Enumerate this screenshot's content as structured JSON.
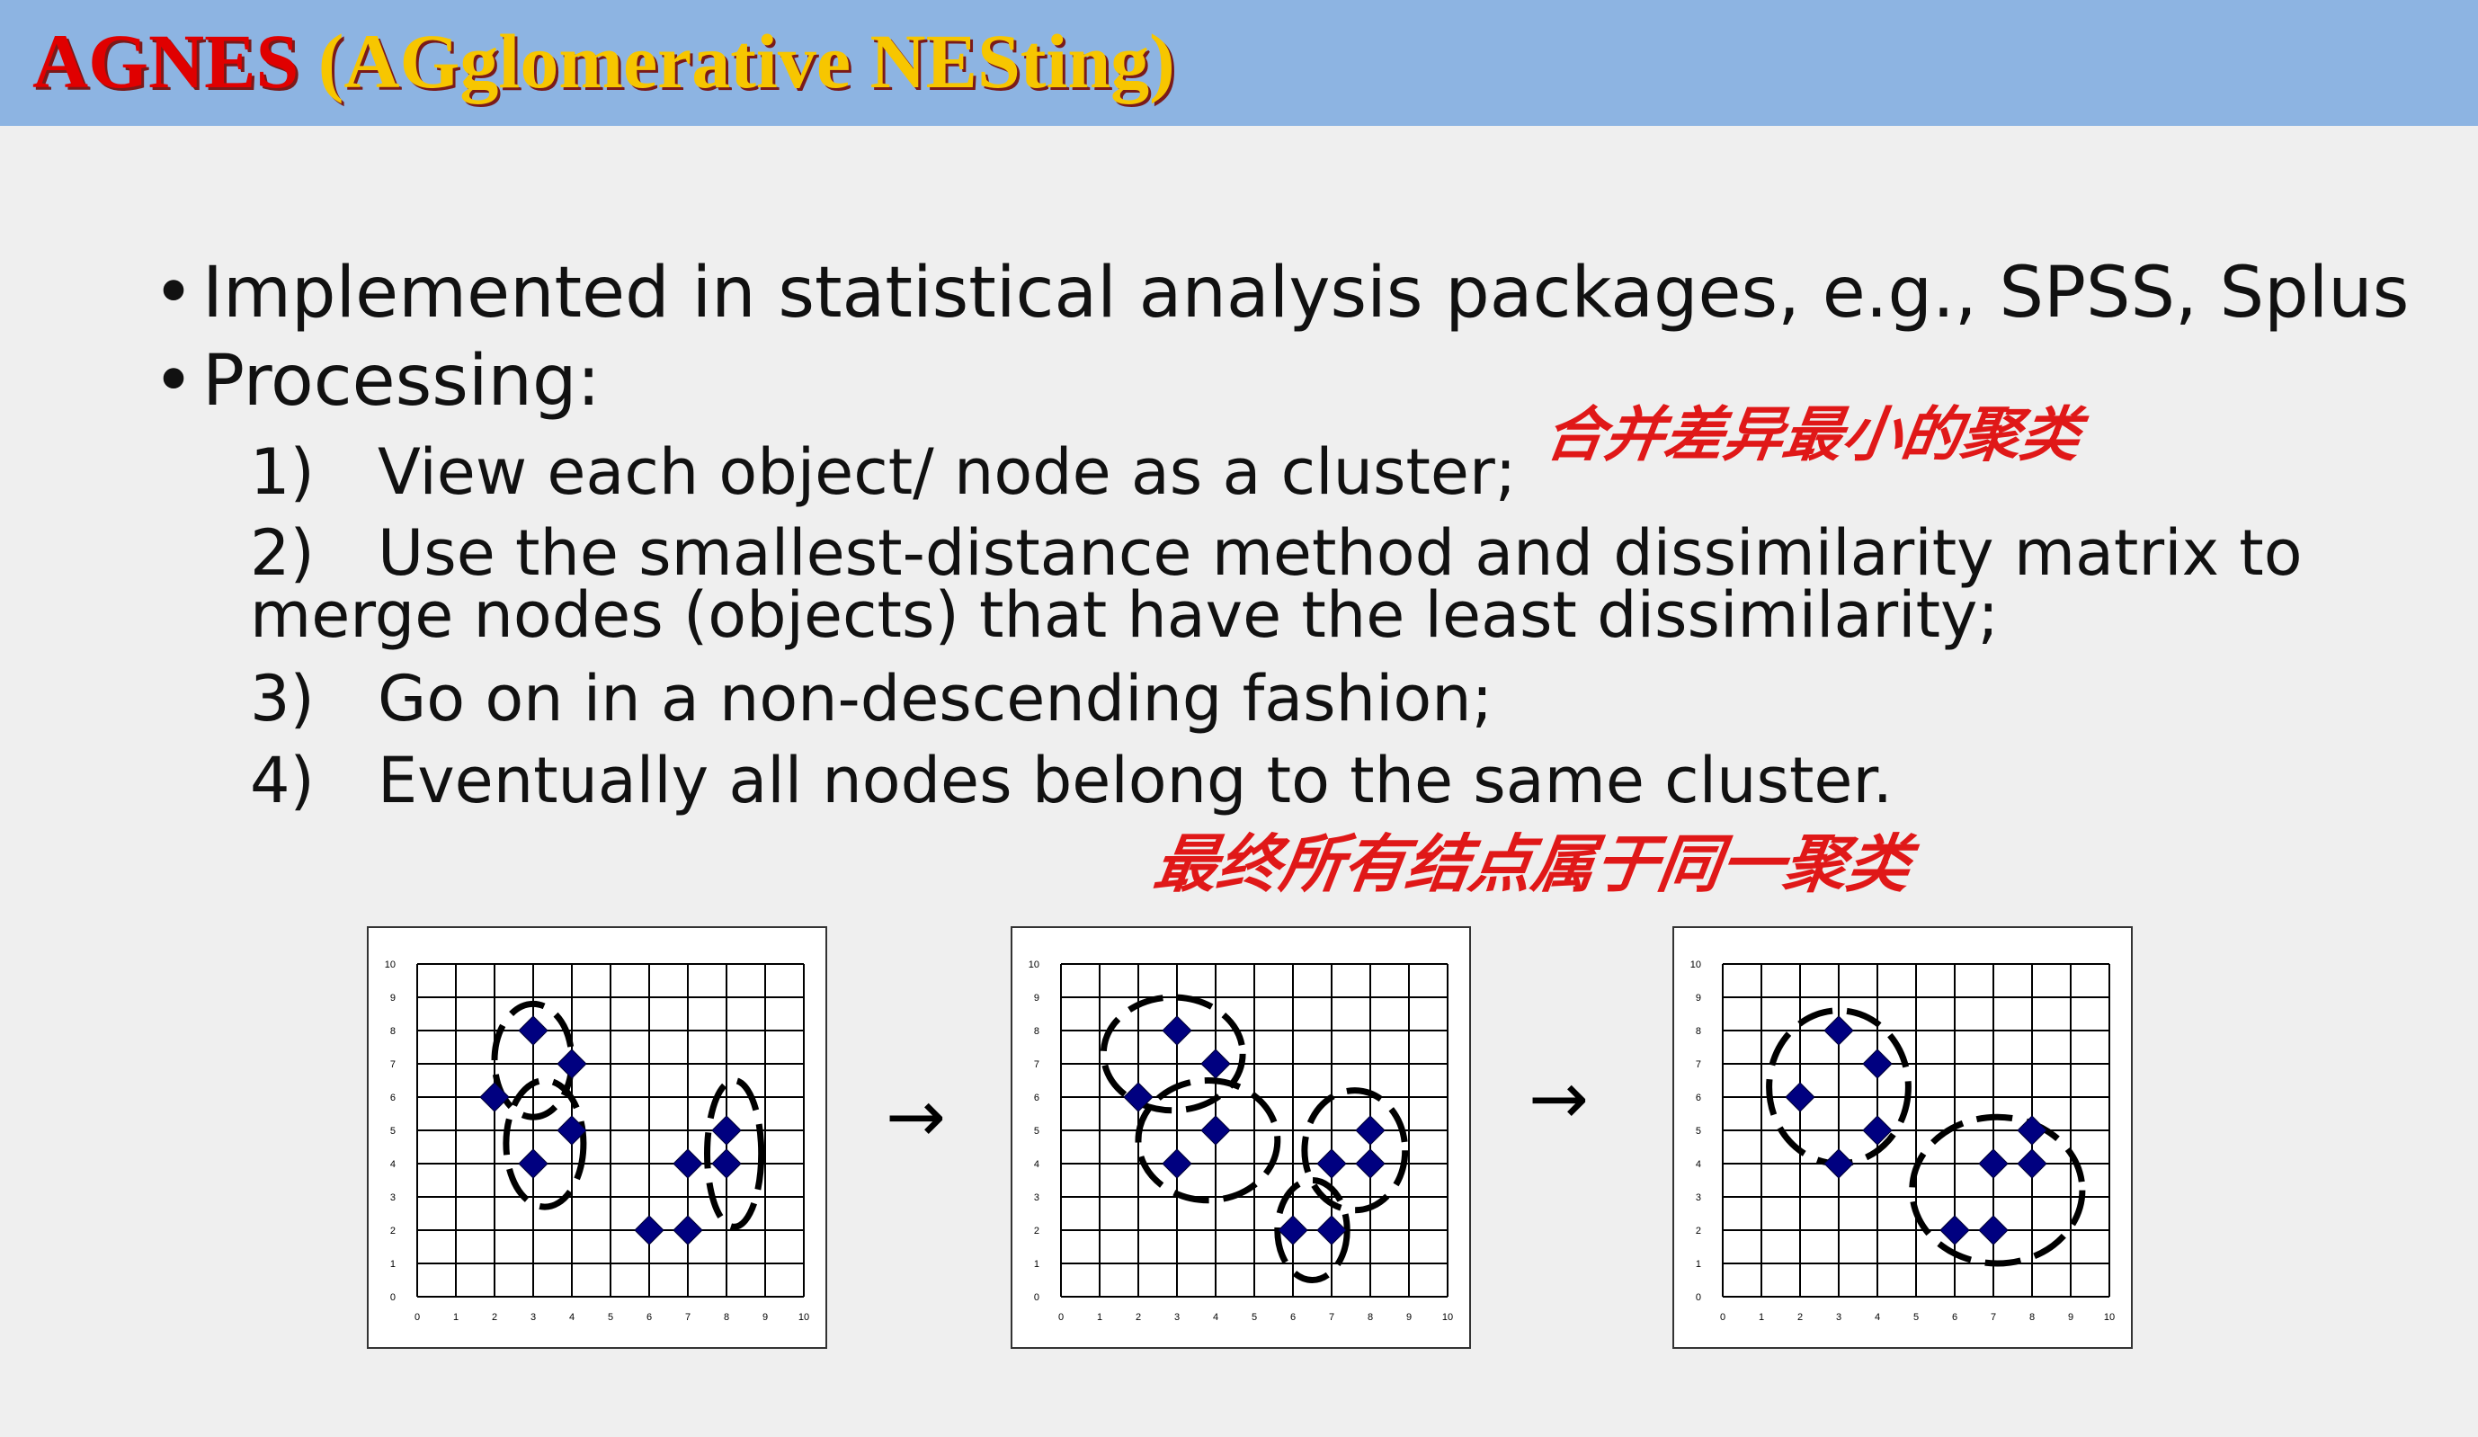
{
  "header": {
    "title_main": "AGNES ",
    "title_sub": "(AGglomerative NESting)"
  },
  "bullets": [
    "Implemented in statistical analysis packages, e.g., SPSS,  Splus",
    "Processing:"
  ],
  "bullet_glyph": "•",
  "steps": [
    {
      "num": "1)",
      "text": "View each object/ node as a cluster;"
    },
    {
      "num": "2)",
      "text": "Use the smallest-distance method and dissimilarity matrix to"
    },
    {
      "num": "",
      "text": "merge nodes (objects) that have the least dissimilarity;"
    },
    {
      "num": "3)",
      "text": "Go on in a non-descending fashion;"
    },
    {
      "num": "4)",
      "text": "Eventually all nodes belong to the same cluster."
    }
  ],
  "annotations": {
    "note1": "合并差异最小的聚类",
    "note2": "最终所有结点属于同一聚类"
  },
  "arrow_glyph": "→",
  "colors": {
    "header_bg": "#8db4e2",
    "title_red": "#e00000",
    "title_yellow": "#f7c600",
    "point": "#000080",
    "ink": "#e01818"
  },
  "chart_data": [
    {
      "type": "scatter",
      "xlim": [
        0,
        10
      ],
      "ylim": [
        0,
        10
      ],
      "x_ticks": [
        "0",
        "1",
        "2",
        "3",
        "4",
        "5",
        "6",
        "7",
        "8",
        "9",
        "10"
      ],
      "y_ticks": [
        "0",
        "1",
        "2",
        "3",
        "4",
        "5",
        "6",
        "7",
        "8",
        "9",
        "10"
      ],
      "points": [
        [
          2,
          6
        ],
        [
          3,
          8
        ],
        [
          4,
          7
        ],
        [
          4,
          5
        ],
        [
          3,
          4
        ],
        [
          6,
          2
        ],
        [
          7,
          2
        ],
        [
          7,
          4
        ],
        [
          8,
          5
        ],
        [
          8,
          4
        ]
      ],
      "clusters": [
        {
          "cx": 3,
          "cy": 7.1,
          "rx": 1.0,
          "ry": 1.7
        },
        {
          "cx": 3.3,
          "cy": 4.6,
          "rx": 1.0,
          "ry": 1.9
        },
        {
          "cx": 8.2,
          "cy": 4.3,
          "rx": 0.7,
          "ry": 2.2
        }
      ]
    },
    {
      "type": "scatter",
      "xlim": [
        0,
        10
      ],
      "ylim": [
        0,
        10
      ],
      "x_ticks": [
        "0",
        "1",
        "2",
        "3",
        "4",
        "5",
        "6",
        "7",
        "8",
        "9",
        "10"
      ],
      "y_ticks": [
        "0",
        "1",
        "2",
        "3",
        "4",
        "5",
        "6",
        "7",
        "8",
        "9",
        "10"
      ],
      "points": [
        [
          2,
          6
        ],
        [
          3,
          8
        ],
        [
          4,
          7
        ],
        [
          4,
          5
        ],
        [
          3,
          4
        ],
        [
          6,
          2
        ],
        [
          7,
          2
        ],
        [
          7,
          4
        ],
        [
          8,
          5
        ],
        [
          8,
          4
        ]
      ],
      "clusters": [
        {
          "cx": 2.9,
          "cy": 7.3,
          "rx": 1.8,
          "ry": 1.7
        },
        {
          "cx": 3.8,
          "cy": 4.7,
          "rx": 1.8,
          "ry": 1.8
        },
        {
          "cx": 7.6,
          "cy": 4.4,
          "rx": 1.3,
          "ry": 1.8
        },
        {
          "cx": 6.5,
          "cy": 2.0,
          "rx": 0.9,
          "ry": 1.5
        }
      ]
    },
    {
      "type": "scatter",
      "xlim": [
        0,
        10
      ],
      "ylim": [
        0,
        10
      ],
      "x_ticks": [
        "0",
        "1",
        "2",
        "3",
        "4",
        "5",
        "6",
        "7",
        "8",
        "9",
        "10"
      ],
      "y_ticks": [
        "0",
        "1",
        "2",
        "3",
        "4",
        "5",
        "6",
        "7",
        "8",
        "9",
        "10"
      ],
      "points": [
        [
          2,
          6
        ],
        [
          3,
          8
        ],
        [
          4,
          7
        ],
        [
          4,
          5
        ],
        [
          3,
          4
        ],
        [
          6,
          2
        ],
        [
          7,
          2
        ],
        [
          7,
          4
        ],
        [
          8,
          5
        ],
        [
          8,
          4
        ]
      ],
      "clusters": [
        {
          "cx": 3.0,
          "cy": 6.3,
          "rx": 1.8,
          "ry": 2.3
        },
        {
          "cx": 7.1,
          "cy": 3.2,
          "rx": 2.2,
          "ry": 2.2
        }
      ]
    }
  ]
}
